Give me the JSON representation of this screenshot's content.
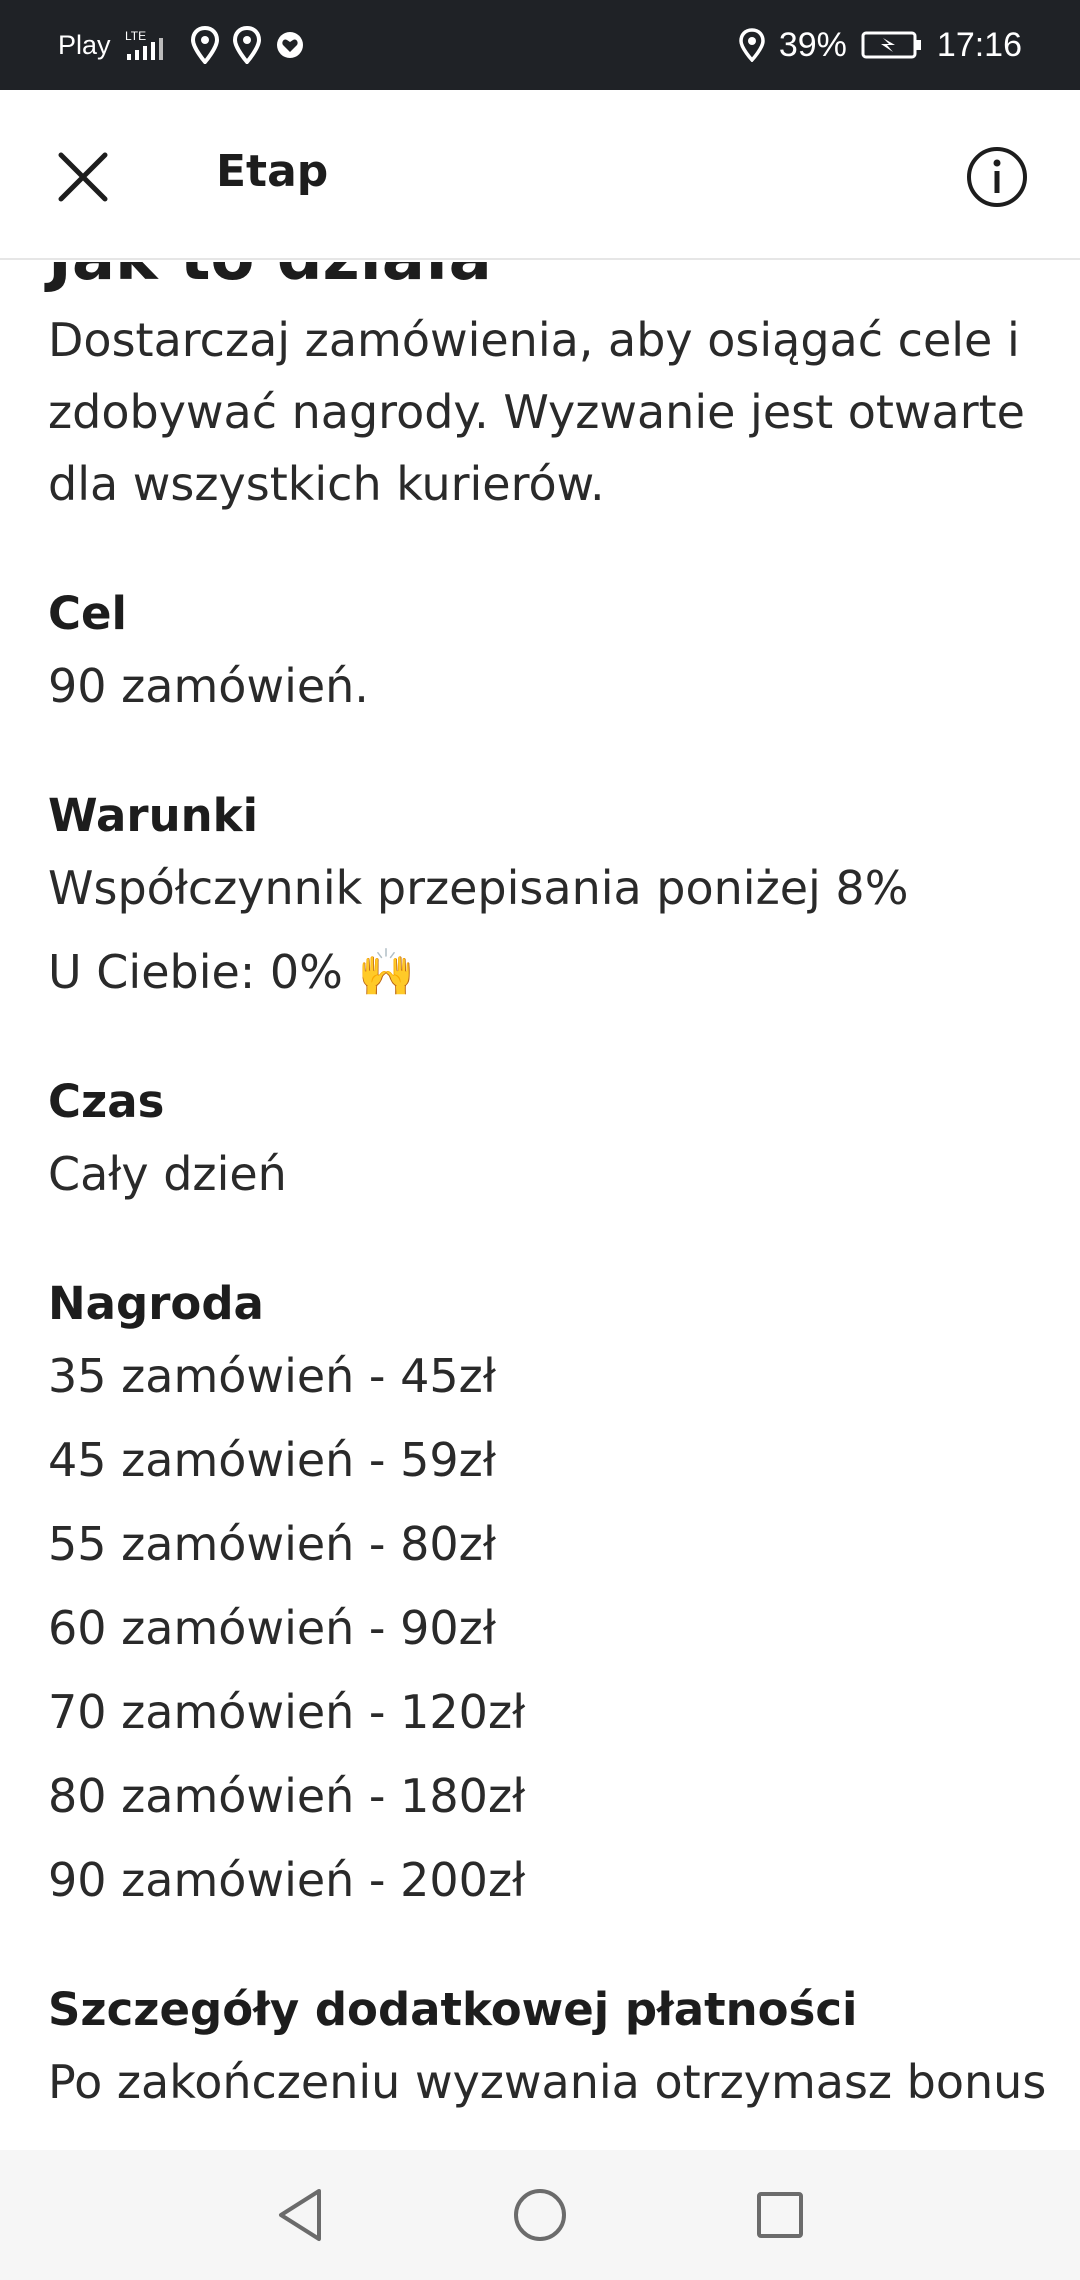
{
  "status_bar": {
    "carrier": "Play",
    "network": "LTE",
    "battery_percent": "39%",
    "time": "17:16",
    "icons": [
      "signal-icon",
      "location-pin-icon",
      "location-pin-icon",
      "heart-icon",
      "location-icon",
      "battery-charging-icon"
    ]
  },
  "app_bar": {
    "title": "Etap",
    "close_icon": "close-icon",
    "info_icon": "info-icon"
  },
  "content": {
    "heading": "Jak to działa",
    "intro": "Dostarczaj zamówienia, aby osiągać cele i zdobywać nagrody. Wyzwanie jest otwarte dla wszystkich kurierów.",
    "goal": {
      "title": "Cel",
      "value": "90 zamówień."
    },
    "conditions": {
      "title": "Warunki",
      "line1": "Współczynnik przepisania poniżej 8%",
      "line2": "U Ciebie: 0% 🙌"
    },
    "time": {
      "title": "Czas",
      "value": "Cały dzień"
    },
    "reward": {
      "title": "Nagroda",
      "items": [
        "35 zamówień - 45zł",
        "45 zamówień - 59zł",
        "55 zamówień - 80zł",
        "60 zamówień - 90zł",
        "70 zamówień - 120zł",
        "80 zamówień - 180zł",
        "90 zamówień - 200zł"
      ]
    },
    "payment_details": {
      "title": "Szczegóły dodatkowej płatności",
      "text": "Po zakończeniu wyzwania otrzymasz bonus"
    }
  },
  "nav_bar": {
    "icons": [
      "back-icon",
      "home-icon",
      "recents-icon"
    ]
  }
}
